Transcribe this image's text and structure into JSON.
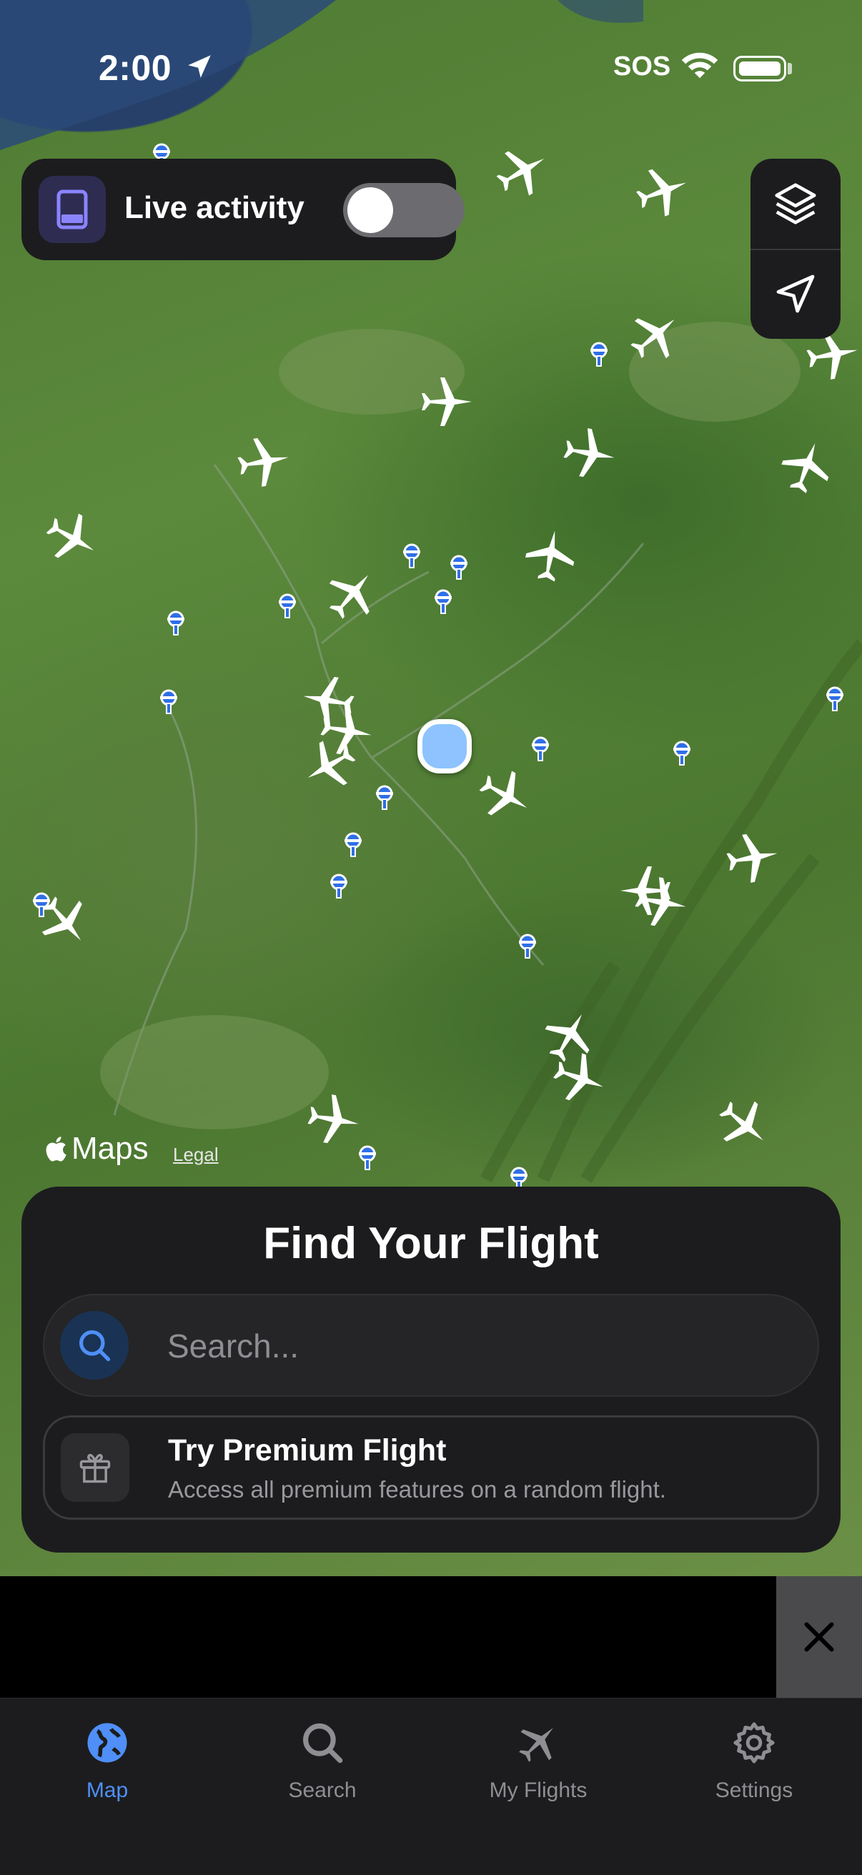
{
  "status_bar": {
    "time": "2:00",
    "carrier": "SOS"
  },
  "live_activity": {
    "label": "Live activity",
    "toggle_on": false
  },
  "map": {
    "brand": "Maps",
    "legal": "Legal"
  },
  "sheet": {
    "title": "Find Your Flight",
    "search_placeholder": "Search...",
    "premium_title": "Try Premium Flight",
    "premium_subtitle": "Access all premium features on a random flight."
  },
  "tabs": [
    {
      "label": "Map",
      "icon": "globe-icon",
      "active": true
    },
    {
      "label": "Search",
      "icon": "search-icon",
      "active": false
    },
    {
      "label": "My Flights",
      "icon": "airplane-icon",
      "active": false
    },
    {
      "label": "Settings",
      "icon": "gear-icon",
      "active": false
    }
  ],
  "colors": {
    "accent": "#4f8ff7",
    "panel": "#1c1c1e",
    "airport": "#2f6fe6"
  }
}
